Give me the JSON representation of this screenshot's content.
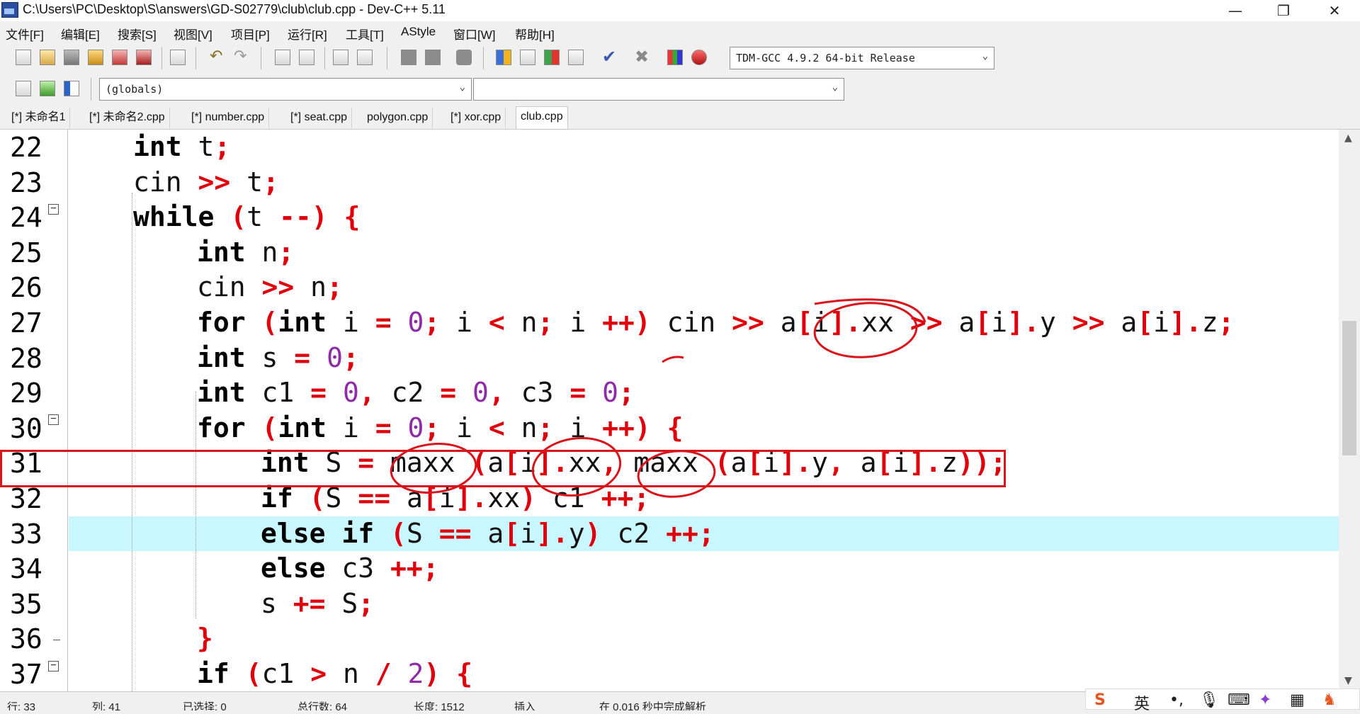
{
  "window": {
    "title": "C:\\Users\\PC\\Desktop\\S\\answers\\GD-S02779\\club\\club.cpp - Dev-C++ 5.11",
    "minimize": "—",
    "restore": "❐",
    "close": "✕"
  },
  "menu": [
    "文件[F]",
    "编辑[E]",
    "搜索[S]",
    "视图[V]",
    "项目[P]",
    "运行[R]",
    "工具[T]",
    "AStyle",
    "窗口[W]",
    "帮助[H]"
  ],
  "toolbar": {
    "compiler": "TDM-GCC 4.9.2 64-bit Release",
    "scope": "(globals)",
    "symbol": ""
  },
  "tabs": [
    "[*] 未命名1",
    "[*] 未命名2.cpp",
    "[*] number.cpp",
    "[*] seat.cpp",
    "polygon.cpp",
    "[*] xor.cpp",
    "club.cpp"
  ],
  "active_tab": "club.cpp",
  "code": [
    {
      "num": "22",
      "text": "int t;"
    },
    {
      "num": "23",
      "text": "cin >> t;"
    },
    {
      "num": "24",
      "text": "while (t --) {"
    },
    {
      "num": "25",
      "text": "int n;"
    },
    {
      "num": "26",
      "text": "cin >> n;"
    },
    {
      "num": "27",
      "text": "for (int i = 0; i < n; i ++) cin >> a[i].xx >> a[i].y >> a[i].z;"
    },
    {
      "num": "28",
      "text": "int s = 0;"
    },
    {
      "num": "29",
      "text": "int c1 = 0, c2 = 0, c3 = 0;"
    },
    {
      "num": "30",
      "text": "for (int i = 0; i < n; i ++) {"
    },
    {
      "num": "31",
      "text": "int S = maxx (a[i].xx, maxx (a[i].y, a[i].z));"
    },
    {
      "num": "32",
      "text": "if (S == a[i].xx) c1 ++;"
    },
    {
      "num": "33",
      "text": "else if (S == a[i].y) c2 ++;"
    },
    {
      "num": "34",
      "text": "else c3 ++;"
    },
    {
      "num": "35",
      "text": "s += S;"
    },
    {
      "num": "36",
      "text": "}"
    },
    {
      "num": "37",
      "text": "if (c1 > n / 2) {"
    }
  ],
  "current_line": "33",
  "marked_line": "31",
  "status": {
    "row_label": "行: 33",
    "col_label": "列: 41",
    "sel_label": "已选择: 0",
    "total_label": "总行数: 64",
    "len_label": "长度: 1512",
    "mode": "插入",
    "parse": "在 0.016 秒中完成解析"
  },
  "ime": {
    "logo": "S",
    "lang": "英"
  },
  "colors": {
    "keyword": "#000000",
    "punct": "#e0000b",
    "number": "#8f2aa8",
    "highlight": "#c9f7ff",
    "annotation": "#d9141b"
  }
}
